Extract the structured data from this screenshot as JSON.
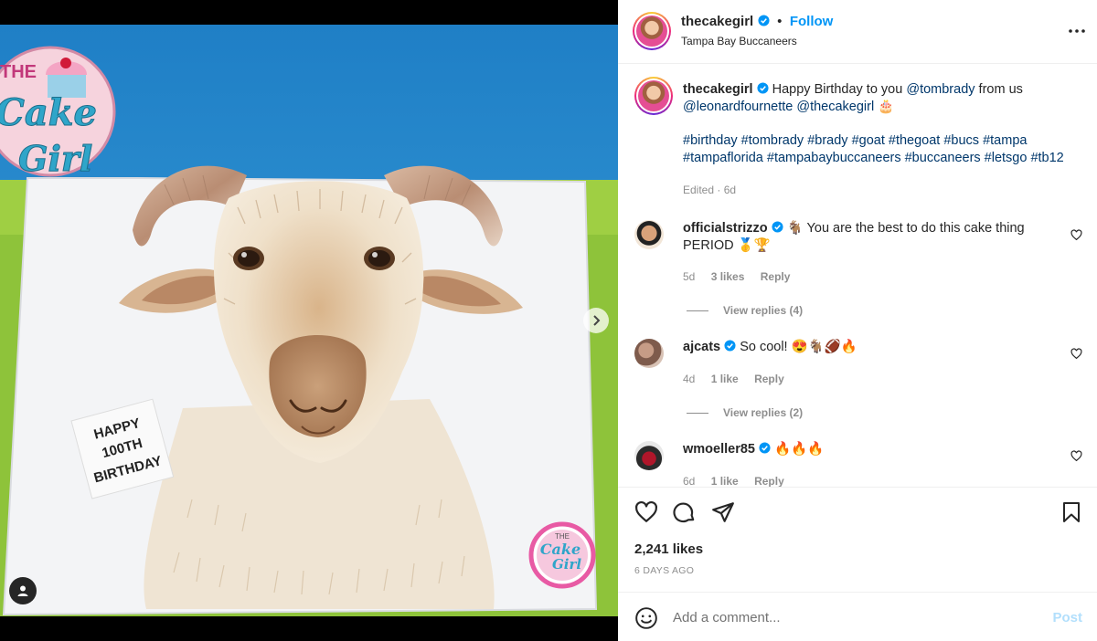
{
  "post": {
    "author": "thecakegirl",
    "follow_label": "Follow",
    "location": "Tampa Bay Buccaneers",
    "caption_line1_text": "Happy Birthday to you",
    "caption_mention1": "@tombrady",
    "caption_line1_suffix": "from us",
    "caption_mention2": "@leonardfournette",
    "caption_mention3": "@thecakegirl",
    "caption_emoji": "🎂",
    "hashtags_line1": "#birthday #tombrady #brady #goat #thegoat #bucs #tampa",
    "hashtags_line2": "#tampaflorida #tampabaybuccaneers #buccaneers #letsgo #tb12",
    "edited": "Edited · 6d",
    "likes": "2,241 likes",
    "time_ago": "6 DAYS AGO"
  },
  "image": {
    "sign_text": [
      "HAPPY",
      "100TH",
      "BIRTHDAY"
    ],
    "logo_top": [
      "THE",
      "Cake",
      "Girl"
    ],
    "logo_bottom": [
      "THE",
      "Cake",
      "Girl"
    ]
  },
  "comments": [
    {
      "username": "officialstrizzo",
      "text_line1": "🐐 You are the best to do this cake thing",
      "text_line2": "PERIOD 🥇🏆",
      "age": "5d",
      "likes": "3 likes",
      "reply": "Reply",
      "view_replies": "View replies (4)"
    },
    {
      "username": "ajcats",
      "text_line1": "So cool! 😍🐐🏈🔥",
      "age": "4d",
      "likes": "1 like",
      "reply": "Reply",
      "view_replies": "View replies (2)"
    },
    {
      "username": "wmoeller85",
      "text_line1": "🔥🔥🔥",
      "age": "6d",
      "likes": "1 like",
      "reply": "Reply"
    }
  ],
  "composer": {
    "placeholder": "Add a comment...",
    "post_label": "Post"
  },
  "icons": [
    "heart-icon",
    "comment-icon",
    "share-icon",
    "bookmark-icon",
    "emoji-icon",
    "more-icon",
    "verified-icon",
    "chevron-right-icon",
    "user-tag-icon"
  ],
  "colors": {
    "accent": "#0095f6",
    "link": "#00376b",
    "muted": "#8e8e8e",
    "post_disabled": "#b2dffc",
    "verified": "#0095f6"
  }
}
